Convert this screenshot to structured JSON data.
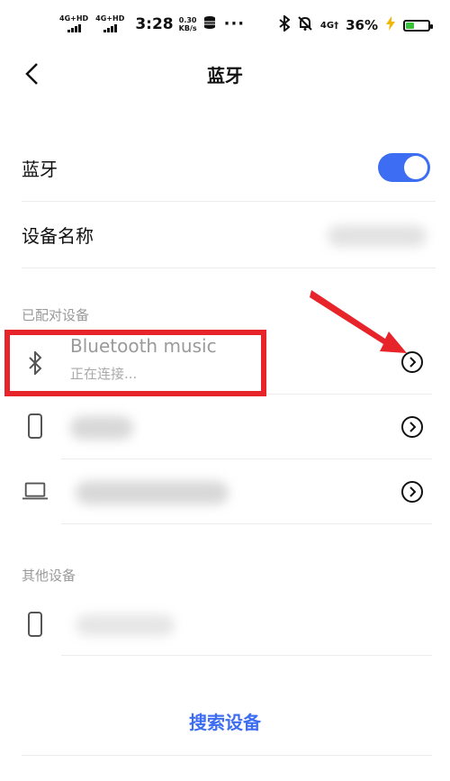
{
  "status_bar": {
    "signal1": "4G+HD",
    "signal2": "4G+HD",
    "time": "3:28",
    "speed_value": "0.30",
    "speed_unit": "KB/s",
    "more": "···",
    "network": "4G†",
    "battery_percent": "36%",
    "battery_level": 0.36
  },
  "header": {
    "title": "蓝牙"
  },
  "bluetooth": {
    "label": "蓝牙",
    "enabled": true
  },
  "device_name": {
    "label": "设备名称"
  },
  "paired": {
    "section_label": "已配对设备",
    "devices": [
      {
        "icon": "bluetooth-icon",
        "name": "Bluetooth music",
        "status": "正在连接..."
      },
      {
        "icon": "phone-icon"
      },
      {
        "icon": "laptop-icon"
      }
    ]
  },
  "others": {
    "section_label": "其他设备",
    "devices": [
      {
        "icon": "phone-icon"
      }
    ]
  },
  "search_button": "搜索设备",
  "colors": {
    "accent": "#3d6df2",
    "highlight": "#e8242b"
  }
}
